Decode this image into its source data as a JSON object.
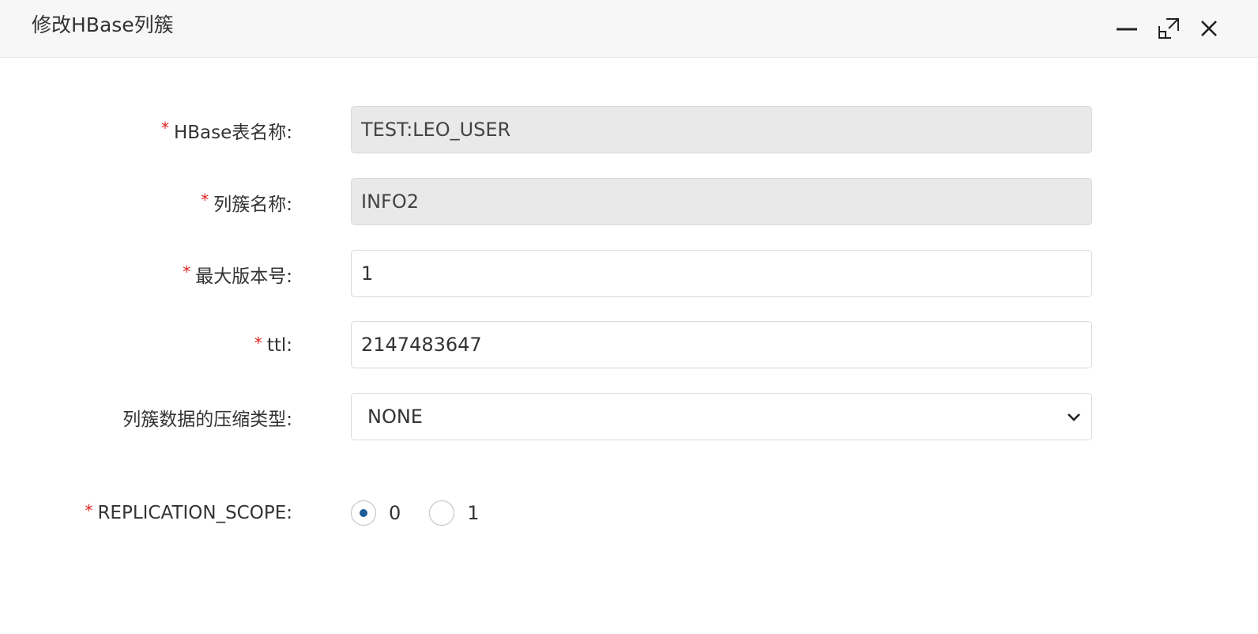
{
  "dialog": {
    "title": "修改HBase列簇"
  },
  "form": {
    "table_name": {
      "label": "HBase表名称:",
      "required": true,
      "value": "TEST:LEO_USER",
      "disabled": true
    },
    "family_name": {
      "label": "列簇名称:",
      "required": true,
      "value": "INFO2",
      "disabled": true
    },
    "max_versions": {
      "label": "最大版本号:",
      "required": true,
      "value": "1"
    },
    "ttl": {
      "label": "ttl:",
      "required": true,
      "value": "2147483647"
    },
    "compression": {
      "label": "列簇数据的压缩类型:",
      "required": false,
      "value": "NONE"
    },
    "replication_scope": {
      "label": "REPLICATION_SCOPE:",
      "required": true,
      "options": [
        "0",
        "1"
      ],
      "selected": "0"
    }
  },
  "icons": {
    "minimize": "minimize-icon",
    "maximize": "maximize-icon",
    "close": "close-icon",
    "chevron": "chevron-down-icon"
  },
  "colors": {
    "required_mark": "#e02020",
    "radio_selected": "#1e5c9a",
    "disabled_input_bg": "#e9e9e9",
    "titlebar_bg": "#f7f7f7"
  }
}
